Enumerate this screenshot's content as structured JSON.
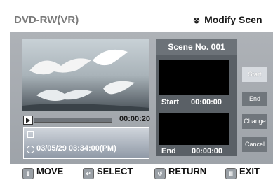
{
  "title": {
    "left": "DVD-RW(VR)",
    "right": "Modify Scen",
    "right_icon": "disc-icon"
  },
  "player": {
    "elapsed": "00:00:20",
    "progress": 0.0,
    "datetime": "03/05/29 03:34:00(PM)"
  },
  "scene": {
    "title": "Scene No. 001",
    "start_label": "Start",
    "start_time": "00:00:00",
    "end_label": "End",
    "end_time": "00:00:00"
  },
  "buttons": {
    "start": "Start",
    "end": "End",
    "change": "Change",
    "cancel": "Cancel"
  },
  "footer": {
    "move": "MOVE",
    "select": "SELECT",
    "return": "RETURN",
    "exit": "EXIT"
  },
  "colors": {
    "panel": "#a7abb1",
    "scene_body": "#5a6066",
    "button": "#70767c"
  }
}
